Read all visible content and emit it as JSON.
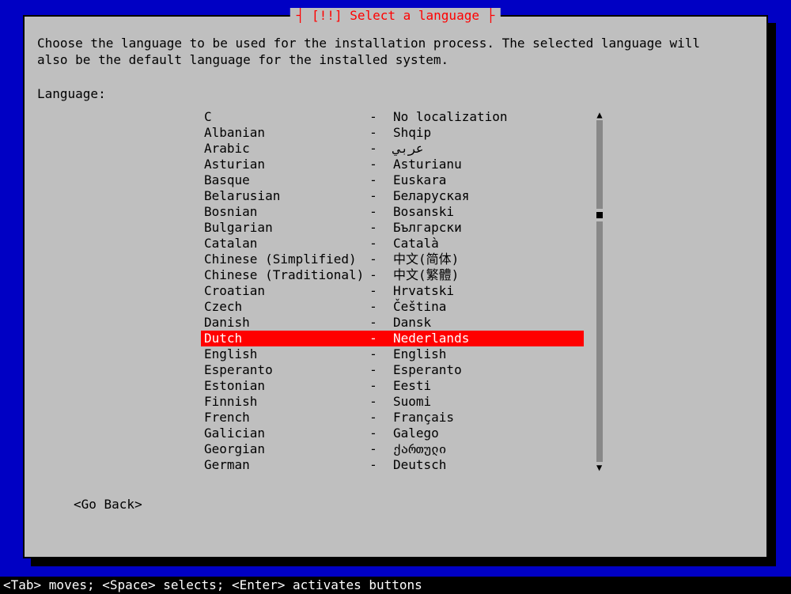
{
  "dialog": {
    "title_decorated": "[!!] Select a language",
    "prompt": "Choose the language to be used for the installation process. The selected language will\nalso be the default language for the installed system.",
    "label": "Language:",
    "selected_index": 14,
    "items": [
      {
        "left": "C",
        "right": "No localization"
      },
      {
        "left": "Albanian",
        "right": "Shqip"
      },
      {
        "left": "Arabic",
        "right": "عربي"
      },
      {
        "left": "Asturian",
        "right": "Asturianu"
      },
      {
        "left": "Basque",
        "right": "Euskara"
      },
      {
        "left": "Belarusian",
        "right": "Беларуская"
      },
      {
        "left": "Bosnian",
        "right": "Bosanski"
      },
      {
        "left": "Bulgarian",
        "right": "Български"
      },
      {
        "left": "Catalan",
        "right": "Català"
      },
      {
        "left": "Chinese (Simplified)",
        "right": "中文(简体)"
      },
      {
        "left": "Chinese (Traditional)",
        "right": "中文(繁體)"
      },
      {
        "left": "Croatian",
        "right": "Hrvatski"
      },
      {
        "left": "Czech",
        "right": "Čeština"
      },
      {
        "left": "Danish",
        "right": "Dansk"
      },
      {
        "left": "Dutch",
        "right": "Nederlands"
      },
      {
        "left": "English",
        "right": "English"
      },
      {
        "left": "Esperanto",
        "right": "Esperanto"
      },
      {
        "left": "Estonian",
        "right": "Eesti"
      },
      {
        "left": "Finnish",
        "right": "Suomi"
      },
      {
        "left": "French",
        "right": "Français"
      },
      {
        "left": "Galician",
        "right": "Galego"
      },
      {
        "left": "Georgian",
        "right": "ქართული"
      },
      {
        "left": "German",
        "right": "Deutsch"
      }
    ],
    "go_back": "<Go Back>",
    "separator": "-"
  },
  "footer": "<Tab> moves; <Space> selects; <Enter> activates buttons",
  "charset": {
    "arrow_up": "▲",
    "arrow_down": "▼"
  }
}
